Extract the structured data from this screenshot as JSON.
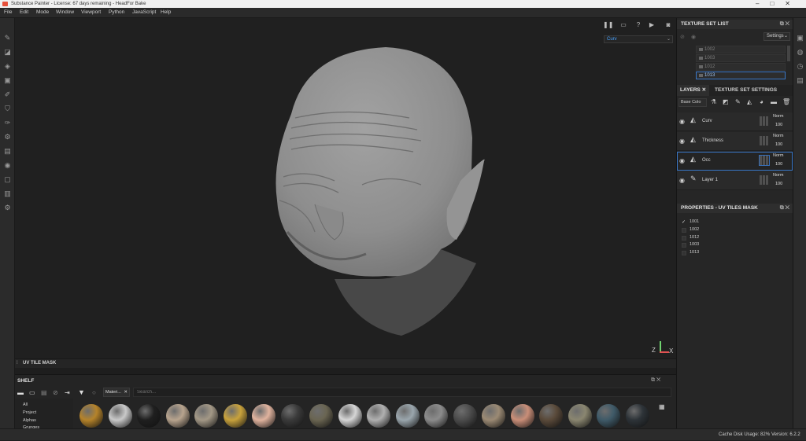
{
  "window": {
    "title": "Substance Painter - License: 67 days remaining - HeadFor Bake"
  },
  "menu": [
    "File",
    "Edit",
    "Mode",
    "Window",
    "Viewport",
    "Python",
    "JavaScript",
    "Help"
  ],
  "viewport": {
    "channel": "Curv",
    "axis": {
      "z": "Z",
      "x": "X"
    },
    "bottom_title": "UV TILE MASK"
  },
  "texture_set_list": {
    "title": "TEXTURE SET LIST",
    "settings_label": "Settings",
    "items": [
      "1002",
      "1003",
      "1012",
      "1013"
    ],
    "active": "1013"
  },
  "layers_panel": {
    "tabs": [
      "LAYERS",
      "TEXTURE SET SETTINGS"
    ],
    "channel_select": "Base Colo",
    "layers": [
      {
        "name": "Curv",
        "blend": "Norm",
        "opacity": "100",
        "type": "fill"
      },
      {
        "name": "Thickness",
        "blend": "Norm",
        "opacity": "100",
        "type": "fill"
      },
      {
        "name": "Occ",
        "blend": "Norm",
        "opacity": "100",
        "type": "fill",
        "selected": true
      },
      {
        "name": "Layer 1",
        "blend": "Norm",
        "opacity": "100",
        "type": "paint"
      }
    ]
  },
  "properties": {
    "title": "PROPERTIES - UV TILES MASK",
    "tiles": [
      {
        "label": "1001",
        "checked": true
      },
      {
        "label": "1002",
        "checked": false
      },
      {
        "label": "1012",
        "checked": false
      },
      {
        "label": "1003",
        "checked": false
      },
      {
        "label": "1013",
        "checked": false
      }
    ]
  },
  "shelf": {
    "title": "SHELF",
    "filter_chip": "Materi...",
    "search_placeholder": "Search...",
    "categories": [
      "All",
      "Project",
      "Alphas",
      "Grunges"
    ],
    "material_colors": [
      "#b5832a",
      "#c9c9c9",
      "#1f1f1f",
      "#b8a48e",
      "#a39886",
      "#c8a23c",
      "#e0b39e",
      "#3a3a3a",
      "#6a6552",
      "#d6d6d6",
      "#b0b0b0",
      "#9aa6ad",
      "#8c8c8c",
      "#4c4c4c",
      "#9b8a74",
      "#c98e78",
      "#5a4a3a",
      "#8a8670",
      "#3f5a68",
      "#2d3338"
    ]
  },
  "status": {
    "cache": "Cache Disk Usage:  82%",
    "version": "Version: 6.2.2"
  }
}
